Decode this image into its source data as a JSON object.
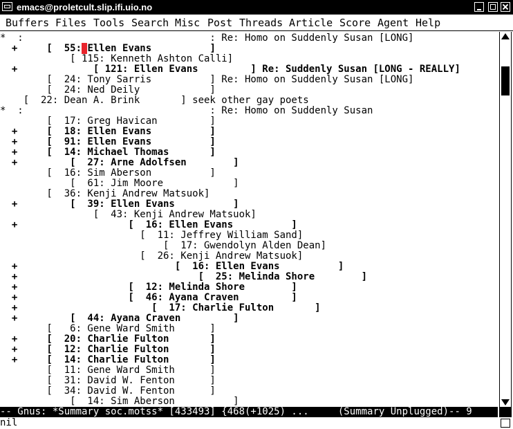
{
  "window": {
    "title": "emacs@proletcult.slip.ifi.uio.no"
  },
  "menu": [
    {
      "label": "Buffers"
    },
    {
      "label": "Files"
    },
    {
      "label": "Tools"
    },
    {
      "label": "Search"
    },
    {
      "label": "Misc"
    },
    {
      "label": "Post"
    },
    {
      "label": "Threads"
    },
    {
      "label": "Article"
    },
    {
      "label": "Score"
    },
    {
      "label": "Agent"
    },
    {
      "label": "Help"
    }
  ],
  "summary_lines": [
    {
      "text": "*  :                                : Re: Homo on Suddenly Susan [LONG]",
      "bold": false
    },
    {
      "text": "  +     [  55: Ellen Evans          ]",
      "bold": true,
      "cursor": true
    },
    {
      "text": "            [ 115: Kenneth Ashton Calli]",
      "bold": false
    },
    {
      "text": "  +             [ 121: Ellen Evans         ] Re: Suddenly Susan [LONG - REALLY]",
      "bold": true
    },
    {
      "text": "        [  24: Tony Sarris          ] Re: Homo on Suddenly Susan [LONG]",
      "bold": false
    },
    {
      "text": "        [  24: Ned Deily            ]",
      "bold": false
    },
    {
      "text": "    [  22: Dean A. Brink       ] seek other gay poets",
      "bold": false
    },
    {
      "text": "*  :                                : Re: Homo on Suddenly Susan",
      "bold": false
    },
    {
      "text": "        [  17: Greg Havican         ]",
      "bold": false
    },
    {
      "text": "  +     [  18: Ellen Evans          ]",
      "bold": true
    },
    {
      "text": "  +     [  91: Ellen Evans          ]",
      "bold": true
    },
    {
      "text": "  +     [  14: Michael Thomas       ]",
      "bold": true
    },
    {
      "text": "  +         [  27: Arne Adolfsen        ]",
      "bold": true
    },
    {
      "text": "        [  16: Sim Aberson          ]",
      "bold": false
    },
    {
      "text": "            [  61: Jim Moore            ]",
      "bold": false
    },
    {
      "text": "        [  36: Kenji Andrew Matsuok]",
      "bold": false
    },
    {
      "text": "  +         [  39: Ellen Evans          ]",
      "bold": true
    },
    {
      "text": "                [  43: Kenji Andrew Matsuok]",
      "bold": false
    },
    {
      "text": "  +                   [  16: Ellen Evans          ]",
      "bold": true
    },
    {
      "text": "                        [  11: Jeffrey William Sand]",
      "bold": false
    },
    {
      "text": "                            [  17: Gwendolyn Alden Dean]",
      "bold": false
    },
    {
      "text": "                        [  26: Kenji Andrew Matsuok]",
      "bold": false
    },
    {
      "text": "  +                           [  16: Ellen Evans          ]",
      "bold": true
    },
    {
      "text": "  +                               [  25: Melinda Shore        ]",
      "bold": true
    },
    {
      "text": "  +                   [  12: Melinda Shore        ]",
      "bold": true
    },
    {
      "text": "  +                   [  46: Ayana Craven         ]",
      "bold": true
    },
    {
      "text": "  +                       [  17: Charlie Fulton       ]",
      "bold": true
    },
    {
      "text": "  +         [  44: Ayana Craven         ]",
      "bold": true
    },
    {
      "text": "        [   6: Gene Ward Smith      ]",
      "bold": false
    },
    {
      "text": "  +     [  20: Charlie Fulton       ]",
      "bold": true
    },
    {
      "text": "  +     [  12: Charlie Fulton       ]",
      "bold": true
    },
    {
      "text": "  +     [  14: Charlie Fulton       ]",
      "bold": true
    },
    {
      "text": "        [  11: Gene Ward Smith      ]",
      "bold": false
    },
    {
      "text": "        [  31: David W. Fenton      ]",
      "bold": false
    },
    {
      "text": "        [  34: David W. Fenton      ]",
      "bold": false
    },
    {
      "text": "            [  14: Sim Aberson          ]",
      "bold": false
    }
  ],
  "modeline": {
    "text": "-- Gnus: *Summary soc.motss* [433493] {468(+1025) ...     (Summary Unplugged)-- 9"
  },
  "minibuffer": {
    "text": "nil"
  },
  "colors": {
    "cursor": "#e8242c",
    "foreground": "#000000",
    "background": "#ffffff"
  },
  "icons": [
    "window-menu-icon",
    "minimize-icon",
    "maximize-icon",
    "close-icon",
    "scroll-up-arrow-icon",
    "scroll-down-arrow-icon"
  ]
}
